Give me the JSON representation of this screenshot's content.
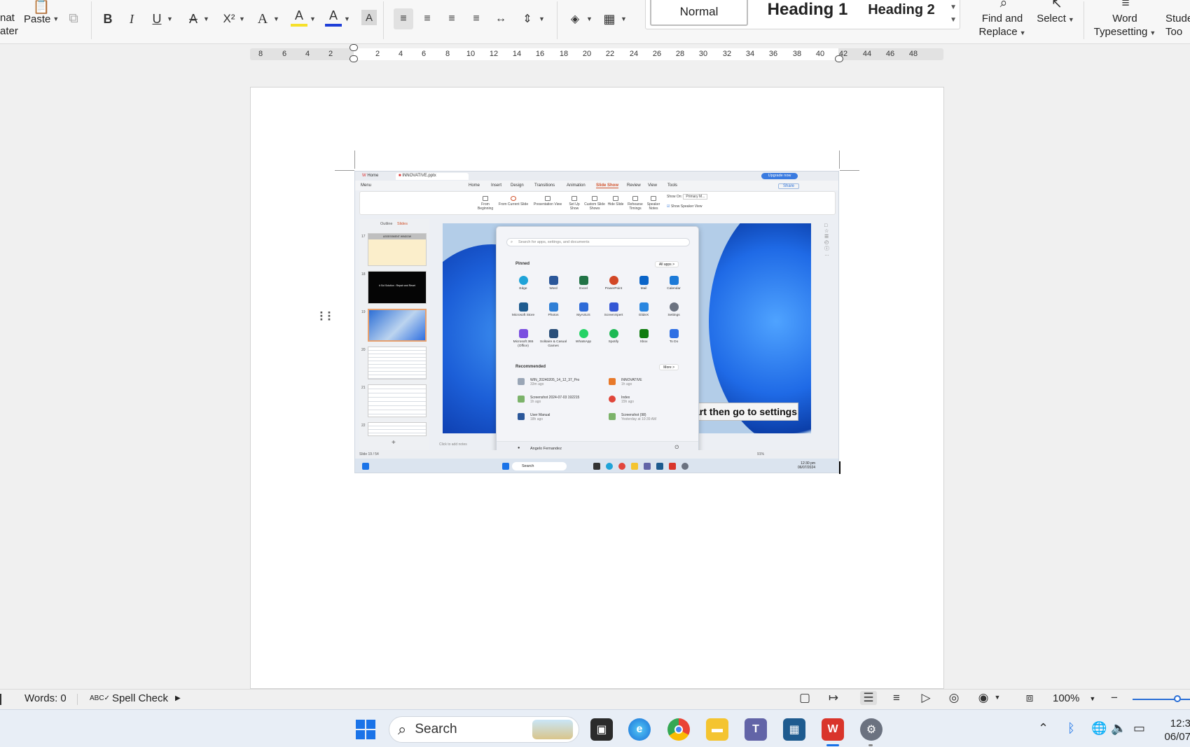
{
  "ribbon": {
    "format_painter": {
      "line1": "nat",
      "line2": "ater"
    },
    "paste_label": "Paste",
    "bold": "B",
    "italic": "I",
    "underline": "U",
    "strike": "A",
    "superscript": "X²",
    "font_effects": "A",
    "highlight": "A",
    "font_color": "A",
    "char_shading": "A",
    "styles": {
      "normal": "Normal",
      "heading1": "Heading 1",
      "heading2": "Heading 2"
    },
    "find_replace": {
      "line1": "Find and",
      "line2": "Replace"
    },
    "select": "Select",
    "word_typesetting": {
      "line1": "Word",
      "line2": "Typesetting"
    },
    "student_tools": {
      "line1": "Stude",
      "line2": "Too"
    }
  },
  "ruler": {
    "left_numbers": [
      "8",
      "6",
      "4",
      "2"
    ],
    "right_numbers": [
      "2",
      "4",
      "6",
      "8",
      "10",
      "12",
      "14",
      "16",
      "18",
      "20",
      "22",
      "24",
      "26",
      "28",
      "30",
      "32",
      "34",
      "36",
      "38",
      "40",
      "42",
      "44",
      "46",
      "48"
    ]
  },
  "embedded": {
    "tabs": {
      "home": "Home",
      "file": "INNOVATIVE.pptx"
    },
    "upgrade": "Upgrade now",
    "menu": [
      "Menu",
      "Home",
      "Insert",
      "Design",
      "Transitions",
      "Animation",
      "Slide Show",
      "Review",
      "View",
      "Tools"
    ],
    "share": "Share",
    "ribbon_items": [
      "From Beginning",
      "From Current Slide",
      "Presentation View",
      "Set Up Show",
      "Custom Slide Shows",
      "Hide Slide",
      "Rehearse Timings",
      "Speaker Notes"
    ],
    "show_on": "Show On:",
    "show_on_value": "Primary M...",
    "speaker_view": "Show Speaker View",
    "panel_tabs": {
      "outline": "Outline",
      "slides": "Slides"
    },
    "slide_numbers": [
      "17",
      "18",
      "19",
      "20",
      "21",
      "22"
    ],
    "thumb_text": {
      "s17": "ASSESSMENT WINDOW",
      "s18": "# Sol Solution : Repair and Reset"
    },
    "caption": "art then go to settings",
    "start_menu": {
      "search_placeholder": "Search for apps, settings, and documents",
      "pinned": "Pinned",
      "all_apps": "All apps  >",
      "apps": [
        {
          "name": "Edge",
          "color": "#1fa3d8"
        },
        {
          "name": "Word",
          "color": "#2b579a"
        },
        {
          "name": "Excel",
          "color": "#217346"
        },
        {
          "name": "PowerPoint",
          "color": "#d24726"
        },
        {
          "name": "Mail",
          "color": "#0a64c8"
        },
        {
          "name": "Calendar",
          "color": "#1c7ad8"
        },
        {
          "name": "Microsoft Store",
          "color": "#1e5b8f"
        },
        {
          "name": "Photos",
          "color": "#2f7fd6"
        },
        {
          "name": "MyASUS",
          "color": "#2e6bd8"
        },
        {
          "name": "ScreenXpert",
          "color": "#3457d5"
        },
        {
          "name": "GlideX",
          "color": "#2a86e0"
        },
        {
          "name": "Settings",
          "color": "#6b7280"
        },
        {
          "name": "Microsoft 365 (Office)",
          "color": "#7a4ee0"
        },
        {
          "name": "Solitaire & Casual Games",
          "color": "#2a4f7a"
        },
        {
          "name": "WhatsApp",
          "color": "#25d366"
        },
        {
          "name": "Spotify",
          "color": "#1db954"
        },
        {
          "name": "Xbox",
          "color": "#107c10"
        },
        {
          "name": "To Do",
          "color": "#2f6fe4"
        }
      ],
      "recommended": "Recommended",
      "more": "More  >",
      "rec_items": [
        {
          "title": "WIN_20240205_14_12_37_Pro",
          "time": "33m ago"
        },
        {
          "title": "INNOVATIVE",
          "time": "1h ago"
        },
        {
          "title": "Screenshot 2024-07-03 192215",
          "time": "1h ago"
        },
        {
          "title": "Index",
          "time": "15h ago"
        },
        {
          "title": "User Manual",
          "time": "18h ago"
        },
        {
          "title": "Screenshot (98)",
          "time": "Yesterday at 10:39 AM"
        }
      ],
      "user": "Angelo Fernandez"
    },
    "notes": "Click to add notes",
    "status": "Slide 19 / 54",
    "zoom": "91%",
    "taskbar_search": "Search",
    "clock": {
      "time": "12:30 pm",
      "date": "06/07/2024"
    }
  },
  "statusbar": {
    "words": "Words: 0",
    "spell_check": "Spell Check",
    "zoom": "100%"
  },
  "taskbar": {
    "search": "Search",
    "clock_line1": "12:3",
    "clock_line2": "06/07"
  }
}
